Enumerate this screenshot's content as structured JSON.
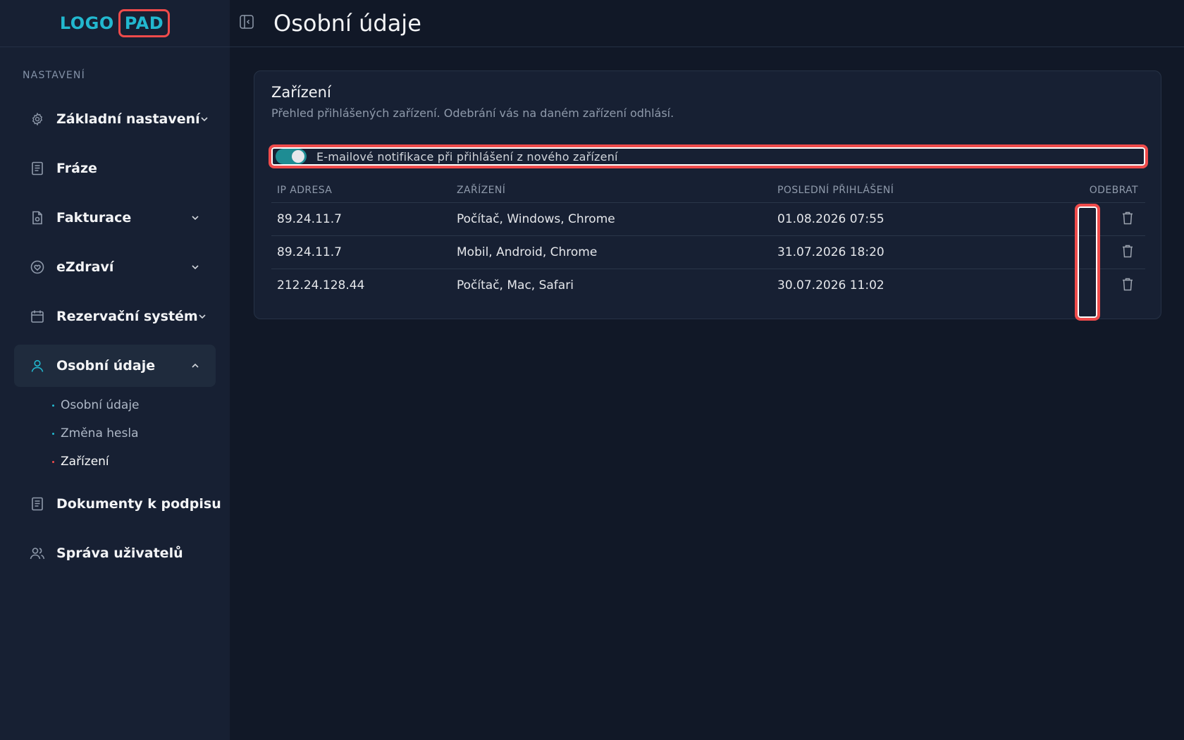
{
  "logo": {
    "word": "LOGO",
    "pad": "PAD"
  },
  "sidebar": {
    "section_title": "NASTAVENÍ",
    "items": [
      {
        "label": "Základní nastavení",
        "icon": "gear-icon",
        "has_chevron": true
      },
      {
        "label": "Fráze",
        "icon": "document-icon",
        "has_chevron": false
      },
      {
        "label": "Fakturace",
        "icon": "invoice-icon",
        "has_chevron": true
      },
      {
        "label": "eZdraví",
        "icon": "heart-icon",
        "has_chevron": true
      },
      {
        "label": "Rezervační systém",
        "icon": "calendar-icon",
        "has_chevron": true
      },
      {
        "label": "Osobní údaje",
        "icon": "user-icon",
        "has_chevron": true,
        "expanded": true
      },
      {
        "label": "Dokumenty k podpisu",
        "icon": "document-icon",
        "has_chevron": false
      },
      {
        "label": "Správa uživatelů",
        "icon": "users-icon",
        "has_chevron": false
      }
    ],
    "sub_items": [
      {
        "label": "Osobní údaje"
      },
      {
        "label": "Změna hesla"
      },
      {
        "label": "Zařízení",
        "active": true
      }
    ]
  },
  "header": {
    "title": "Osobní údaje"
  },
  "card": {
    "title": "Zařízení",
    "description": "Přehled přihlášených zařízení. Odebrání vás na daném zařízení odhlásí.",
    "toggle_label": "E-mailové notifikace při přihlášení z nového zařízení",
    "toggle_on": true
  },
  "table": {
    "headers": [
      "IP ADRESA",
      "ZAŘÍZENÍ",
      "POSLEDNÍ PŘIHLÁŠENÍ",
      "ODEBRAT"
    ],
    "rows": [
      {
        "ip": "89.24.11.7",
        "device": "Počítač, Windows, Chrome",
        "last_login": "01.08.2026 07:55"
      },
      {
        "ip": "89.24.11.7",
        "device": "Mobil, Android, Chrome",
        "last_login": "31.07.2026 18:20"
      },
      {
        "ip": "212.24.128.44",
        "device": "Počítač, Mac, Safari",
        "last_login": "30.07.2026 11:02"
      }
    ]
  },
  "colors": {
    "accent": "#22b8cf",
    "highlight": "#ef4b4b",
    "background": "#111827",
    "sidebar": "#172033"
  }
}
